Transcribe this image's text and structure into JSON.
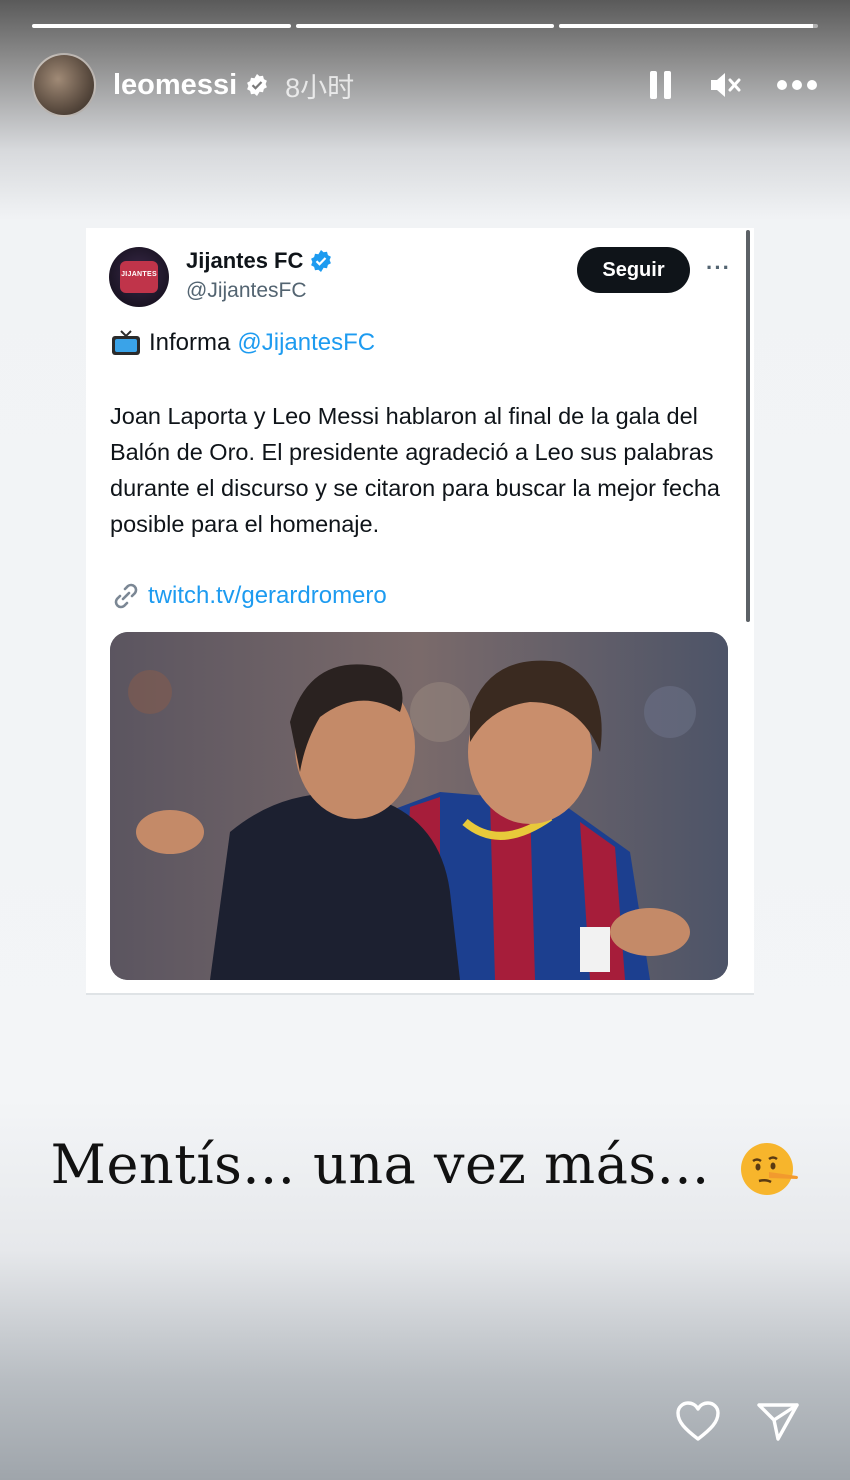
{
  "story": {
    "progress": [
      1.0,
      1.0,
      0.98
    ],
    "username": "leomessi",
    "time_ago": "8小时"
  },
  "tweet": {
    "name": "Jijantes FC",
    "handle": "@JijantesFC",
    "avatar_text": "JIJANTES",
    "follow_label": "Seguir",
    "more_label": "···",
    "informa_label": "Informa",
    "informa_mention": "@JijantesFC",
    "body": "Joan Laporta y Leo Messi hablaron al final de la gala del Balón de Oro. El presidente agradeció a Leo sus palabras  durante el discurso y se citaron para buscar la mejor fecha posible para el homenaje.",
    "link": "twitch.tv/gerardromero"
  },
  "caption": {
    "text": "Mentís... una vez más...",
    "emoji": "lying-face-emoji"
  },
  "icons": {
    "verified": "verified-badge-icon",
    "pause": "pause-icon",
    "mute": "mute-icon",
    "more": "more-icon",
    "tv": "tv-icon",
    "link": "link-icon",
    "heart": "heart-icon",
    "send": "send-icon"
  },
  "colors": {
    "twitter_blue": "#1d9bf0",
    "tweet_text": "#0f1419",
    "handle_gray": "#536471",
    "barca_blue": "#1c3f8f",
    "barca_red": "#a61d3a"
  }
}
